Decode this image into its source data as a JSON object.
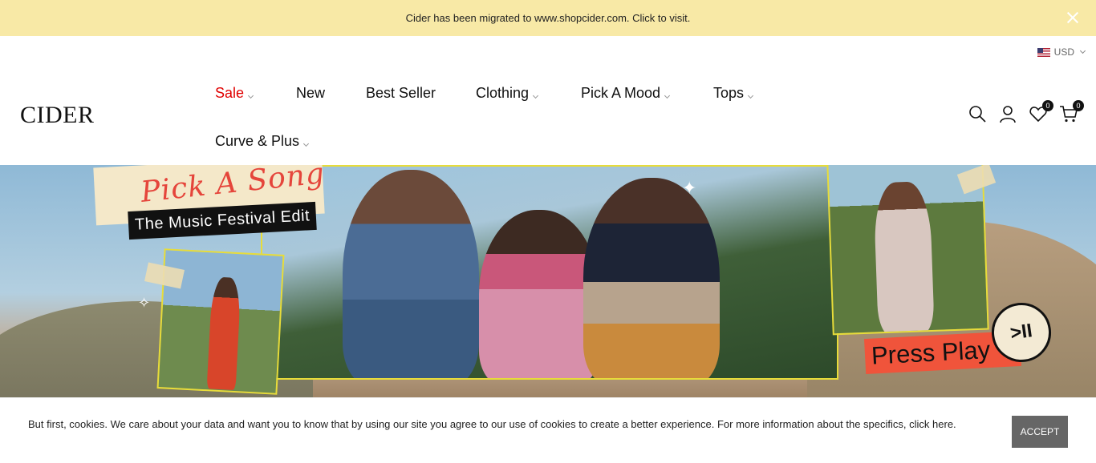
{
  "announcement": {
    "text": "Cider has been migrated to www.shopcider.com. Click to visit.",
    "close_icon": "close-icon",
    "background": "#f8e9a6"
  },
  "currency": {
    "flag": "us-flag-icon",
    "label": "USD"
  },
  "logo": {
    "text": "CIDER"
  },
  "nav": {
    "sale": "Sale",
    "new": "New",
    "best_seller": "Best Seller",
    "clothing": "Clothing",
    "pick_a_mood": "Pick A Mood",
    "tops": "Tops",
    "curve_plus": "Curve & Plus",
    "accent_color": "#e00000"
  },
  "header_icons": {
    "search": "search-icon",
    "account": "user-icon",
    "wishlist": "heart-icon",
    "wishlist_count": "0",
    "cart": "cart-icon",
    "cart_count": "0"
  },
  "hero": {
    "script_title": "Pick A Song",
    "subtitle": "The Music Festival Edit",
    "cta": "Press Play",
    "play_glyph": ">II"
  },
  "cookie": {
    "text": "But first, cookies. We care about your data and want you to know that by using our site you agree to our use of cookies to create a better experience. For more information about the specifics, click ",
    "link": "here.",
    "accept": "ACCEPT"
  }
}
